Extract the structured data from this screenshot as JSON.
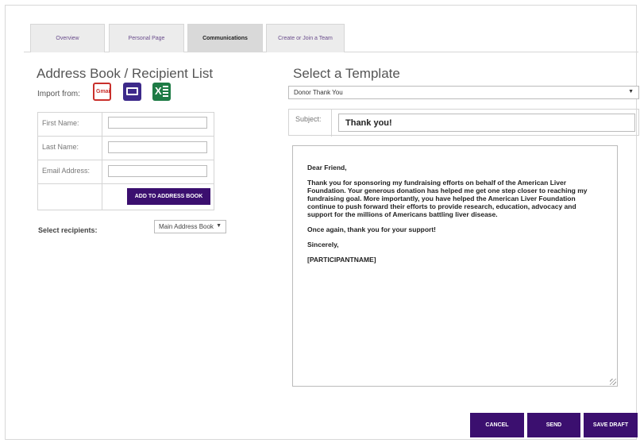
{
  "tabs": [
    {
      "label": "Overview",
      "active": false
    },
    {
      "label": "Personal Page",
      "active": false
    },
    {
      "label": "Communications",
      "active": true
    },
    {
      "label": "Create or Join a Team",
      "active": false
    }
  ],
  "address_book": {
    "title": "Address Book / Recipient List",
    "import_label": "Import from:",
    "import_sources": [
      {
        "icon": "gmail-icon",
        "label": "Gmail"
      },
      {
        "icon": "yahoo-mail-icon",
        "label": "YAHOO!"
      },
      {
        "icon": "excel-icon",
        "label": "X"
      }
    ],
    "fields": [
      {
        "label": "First Name:",
        "value": ""
      },
      {
        "label": "Last Name:",
        "value": ""
      },
      {
        "label": "Email Address:",
        "value": ""
      }
    ],
    "add_button": "ADD TO ADDRESS BOOK",
    "select_recipients_label": "Select recipients:",
    "recipient_list_selected": "Main Address Book"
  },
  "template": {
    "title": "Select a Template",
    "selected": "Donor Thank You",
    "subject_label": "Subject:",
    "subject_value": "Thank you!",
    "body_paragraphs": [
      "Dear Friend,",
      "Thank you for sponsoring my fundraising efforts on behalf of the American Liver Foundation. Your generous donation has helped me get one step closer to reaching my fundraising goal. More importantly, you have helped the American Liver Foundation continue to push forward their efforts to provide research, education, advocacy and support for the millions of Americans battling liver disease.",
      "Once again, thank you for your support!",
      "Sincerely,",
      "[PARTICIPANTNAME]"
    ]
  },
  "actions": {
    "cancel": "CANCEL",
    "send": "SEND",
    "save_draft": "SAVE DRAFT"
  },
  "colors": {
    "accent": "#3b0f6f",
    "tab_text": "#6a4d8c",
    "active_tab_bg": "#d9d9d9"
  }
}
